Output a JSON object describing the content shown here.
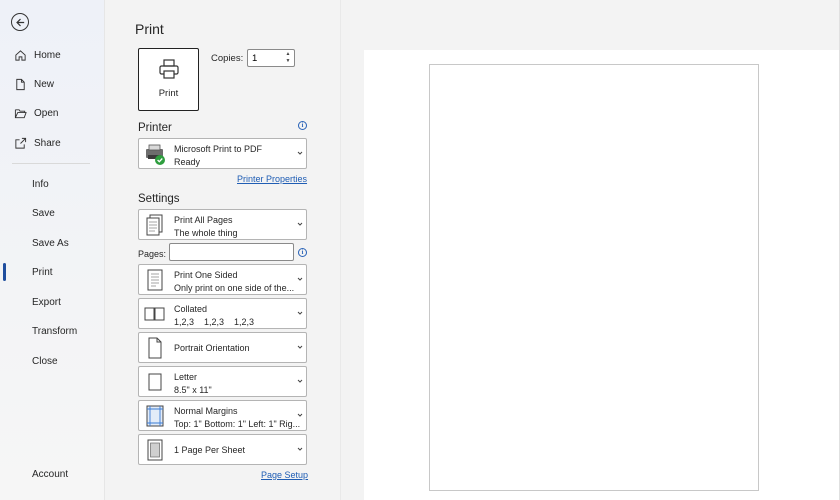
{
  "nav": {
    "items": [
      {
        "label": "Home"
      },
      {
        "label": "New"
      },
      {
        "label": "Open"
      },
      {
        "label": "Share"
      },
      {
        "label": "Info"
      },
      {
        "label": "Save"
      },
      {
        "label": "Save As"
      },
      {
        "label": "Print"
      },
      {
        "label": "Export"
      },
      {
        "label": "Transform"
      },
      {
        "label": "Close"
      },
      {
        "label": "Account"
      }
    ],
    "active": "Print"
  },
  "print": {
    "title": "Print",
    "button_label": "Print",
    "copies_label": "Copies:",
    "copies_value": "1"
  },
  "printer": {
    "heading": "Printer",
    "name": "Microsoft Print to PDF",
    "status": "Ready",
    "properties_link": "Printer Properties"
  },
  "settings": {
    "heading": "Settings",
    "pages_label": "Pages:",
    "pages_value": "",
    "options": [
      {
        "line1": "Print All Pages",
        "line2": "The whole thing"
      },
      {
        "line1": "Print One Sided",
        "line2": "Only print on one side of the..."
      },
      {
        "line1": "Collated",
        "line2": "1,2,3    1,2,3    1,2,3"
      },
      {
        "line1": "Portrait Orientation"
      },
      {
        "line1": "Letter",
        "line2": "8.5\" x 11\""
      },
      {
        "line1": "Normal Margins",
        "line2": "Top: 1\" Bottom: 1\" Left: 1\" Rig..."
      },
      {
        "line1": "1 Page Per Sheet"
      }
    ],
    "page_setup_link": "Page Setup"
  },
  "colors": {
    "accent": "#1f4e9e",
    "link": "#1f5db4",
    "ready_badge": "#2e9e3e"
  }
}
